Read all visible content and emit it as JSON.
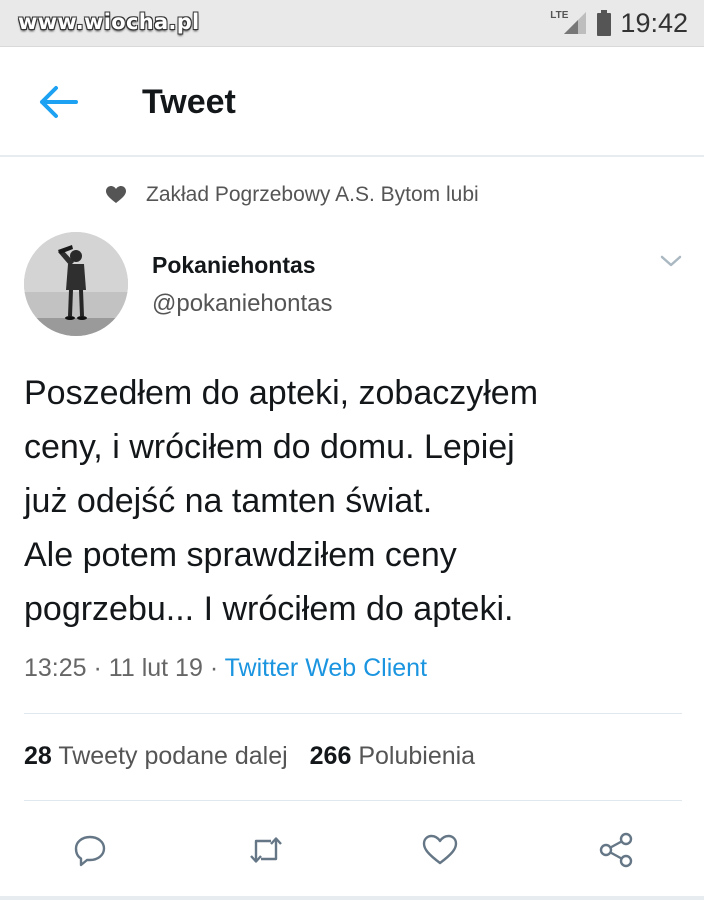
{
  "watermark": "www.wiocha.pl",
  "status_bar": {
    "network": "LTE",
    "time": "19:42"
  },
  "header": {
    "title": "Tweet",
    "back_icon": "arrow-left-icon"
  },
  "social_context": {
    "icon": "heart-filled-icon",
    "text": "Zakład Pogrzebowy A.S. Bytom lubi"
  },
  "author": {
    "name": "Pokaniehontas",
    "handle": "@pokaniehontas"
  },
  "tweet": {
    "text": "Poszedłem do apteki, zobaczyłem\nceny, i wróciłem do domu. Lepiej\njuż odejść na tamten świat.\nAle potem sprawdziłem ceny\npogrzebu... I wróciłem do apteki.",
    "time": "13:25",
    "date": "11 lut 19",
    "separator": "·",
    "source": "Twitter Web Client"
  },
  "stats": {
    "retweets_count": "28",
    "retweets_label": "Tweety podane dalej",
    "likes_count": "266",
    "likes_label": "Polubienia"
  },
  "actions": [
    "reply-icon",
    "retweet-icon",
    "like-icon",
    "share-icon"
  ],
  "colors": {
    "accent": "#1da1f2",
    "link": "#1b95e0",
    "text": "#14171a",
    "muted": "#666666"
  }
}
